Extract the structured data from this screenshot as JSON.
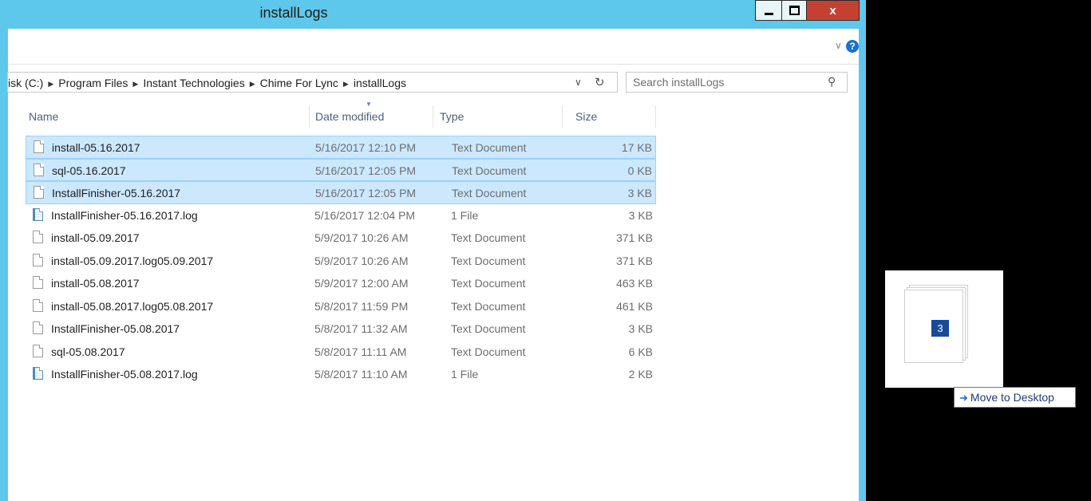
{
  "window": {
    "title": "installLogs",
    "buttons": {
      "minimize": "minimize",
      "maximize": "maximize",
      "close": "x"
    }
  },
  "ribbon": {
    "chevron": "∨",
    "help": "?"
  },
  "address": {
    "breadcrumb": [
      "isk (C:)",
      "Program Files",
      "Instant Technologies",
      "Chime For Lync",
      "installLogs"
    ],
    "dropdown_glyph": "∨",
    "refresh_glyph": "↻"
  },
  "search": {
    "placeholder": "Search installLogs",
    "value": ""
  },
  "columns": {
    "name": "Name",
    "date": "Date modified",
    "type": "Type",
    "size": "Size"
  },
  "files": [
    {
      "name": "install-05.16.2017",
      "date": "5/16/2017 12:10 PM",
      "type": "Text Document",
      "size": "17 KB",
      "selected": true,
      "icon": "text-file-icon"
    },
    {
      "name": "sql-05.16.2017",
      "date": "5/16/2017 12:05 PM",
      "type": "Text Document",
      "size": "0 KB",
      "selected": true,
      "icon": "text-file-icon"
    },
    {
      "name": "InstallFinisher-05.16.2017",
      "date": "5/16/2017 12:05 PM",
      "type": "Text Document",
      "size": "3 KB",
      "selected": true,
      "icon": "text-file-icon"
    },
    {
      "name": "InstallFinisher-05.16.2017.log",
      "date": "5/16/2017 12:04 PM",
      "type": "1 File",
      "size": "3 KB",
      "selected": false,
      "icon": "log-file-icon"
    },
    {
      "name": "install-05.09.2017",
      "date": "5/9/2017 10:26 AM",
      "type": "Text Document",
      "size": "371 KB",
      "selected": false,
      "icon": "text-file-icon"
    },
    {
      "name": "install-05.09.2017.log05.09.2017",
      "date": "5/9/2017 10:26 AM",
      "type": "Text Document",
      "size": "371 KB",
      "selected": false,
      "icon": "text-file-icon"
    },
    {
      "name": "install-05.08.2017",
      "date": "5/9/2017 12:00 AM",
      "type": "Text Document",
      "size": "463 KB",
      "selected": false,
      "icon": "text-file-icon"
    },
    {
      "name": "install-05.08.2017.log05.08.2017",
      "date": "5/8/2017 11:59 PM",
      "type": "Text Document",
      "size": "461 KB",
      "selected": false,
      "icon": "text-file-icon"
    },
    {
      "name": "InstallFinisher-05.08.2017",
      "date": "5/8/2017 11:32 AM",
      "type": "Text Document",
      "size": "3 KB",
      "selected": false,
      "icon": "text-file-icon"
    },
    {
      "name": "sql-05.08.2017",
      "date": "5/8/2017 11:11 AM",
      "type": "Text Document",
      "size": "6 KB",
      "selected": false,
      "icon": "text-file-icon"
    },
    {
      "name": "InstallFinisher-05.08.2017.log",
      "date": "5/8/2017 11:10 AM",
      "type": "1 File",
      "size": "2 KB",
      "selected": false,
      "icon": "log-file-icon"
    }
  ],
  "drag": {
    "count": "3",
    "tooltip": "Move to Desktop"
  },
  "colors": {
    "titlebar": "#5ec8ec",
    "selection": "#cce8ff",
    "close_button": "#c44132",
    "drag_badge": "#174a9a"
  }
}
